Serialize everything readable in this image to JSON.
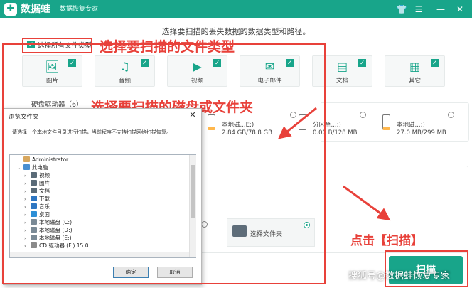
{
  "app": {
    "title": "数据蛙",
    "subtitle": "数据恢复专家",
    "logo_glyph": "✚",
    "window_controls": [
      "👕",
      "☰",
      "—",
      "✕"
    ]
  },
  "instruction": "选择要扫描的丢失数据的数据类型和路径。",
  "select_all": {
    "label": "选择所有文件类型",
    "checked": true
  },
  "annotations": {
    "types": "选择要扫描的文件类型",
    "disk": "选择要扫描的磁盘或文件夹",
    "click": "点击【扫描】"
  },
  "file_types": [
    {
      "label": "图片",
      "icon": "🖼",
      "checked": true
    },
    {
      "label": "音频",
      "icon": "♫",
      "checked": true
    },
    {
      "label": "视频",
      "icon": "▶",
      "checked": true
    },
    {
      "label": "电子邮件",
      "icon": "✉",
      "checked": true
    },
    {
      "label": "文档",
      "icon": "▤",
      "checked": true
    },
    {
      "label": "其它",
      "icon": "▦",
      "checked": true
    }
  ],
  "hdd_section": "硬盘驱动器（6）",
  "drives": [
    {
      "name": "本地磁...E:)",
      "size": "2.84 GB/78.8 GB",
      "color": "#ffb74d"
    },
    {
      "name": "分区至...:)",
      "size": "0.00  B/128 MB",
      "color": "#ffffff"
    },
    {
      "name": "本地磁...:)",
      "size": "27.0 MB/299 MB",
      "color": "#ffb74d"
    }
  ],
  "folder_option": {
    "label": "选择文件夹",
    "selected": true
  },
  "scan_button": "扫描",
  "watermark": "搜狐号@数据蛙恢复专家",
  "dialog": {
    "title": "浏览文件夹",
    "close": "✕",
    "description": "请选择一个本地文件目录进行扫描，当前程序不支持扫描网络扫描恢复。",
    "tree": [
      {
        "label": "Administrator",
        "caret": "",
        "icon_color": "#d7a75e",
        "indent": 0
      },
      {
        "label": "此电脑",
        "caret": "⌄",
        "icon_color": "#4a8fd0",
        "indent": 0
      },
      {
        "label": "视频",
        "caret": "›",
        "icon_color": "#5a6b78",
        "indent": 1
      },
      {
        "label": "图片",
        "caret": "›",
        "icon_color": "#5a6b78",
        "indent": 1
      },
      {
        "label": "文档",
        "caret": "›",
        "icon_color": "#5a6b78",
        "indent": 1
      },
      {
        "label": "下载",
        "caret": "›",
        "icon_color": "#2d76c2",
        "indent": 1
      },
      {
        "label": "音乐",
        "caret": "›",
        "icon_color": "#2d76c2",
        "indent": 1
      },
      {
        "label": "桌面",
        "caret": "›",
        "icon_color": "#2d8fd6",
        "indent": 1
      },
      {
        "label": "本地磁盘 (C:)",
        "caret": "›",
        "icon_color": "#7a8a96",
        "indent": 1
      },
      {
        "label": "本地磁盘 (D:)",
        "caret": "›",
        "icon_color": "#7a8a96",
        "indent": 1
      },
      {
        "label": "本地磁盘 (E:)",
        "caret": "›",
        "icon_color": "#7a8a96",
        "indent": 1
      },
      {
        "label": "CD 驱动器 (F:) 15.0",
        "caret": "›",
        "icon_color": "#8a8a8a",
        "indent": 1
      }
    ],
    "ok": "确定",
    "cancel": "取消"
  },
  "colors": {
    "brand": "#18a58a",
    "annotation_red": "#e8413a"
  }
}
